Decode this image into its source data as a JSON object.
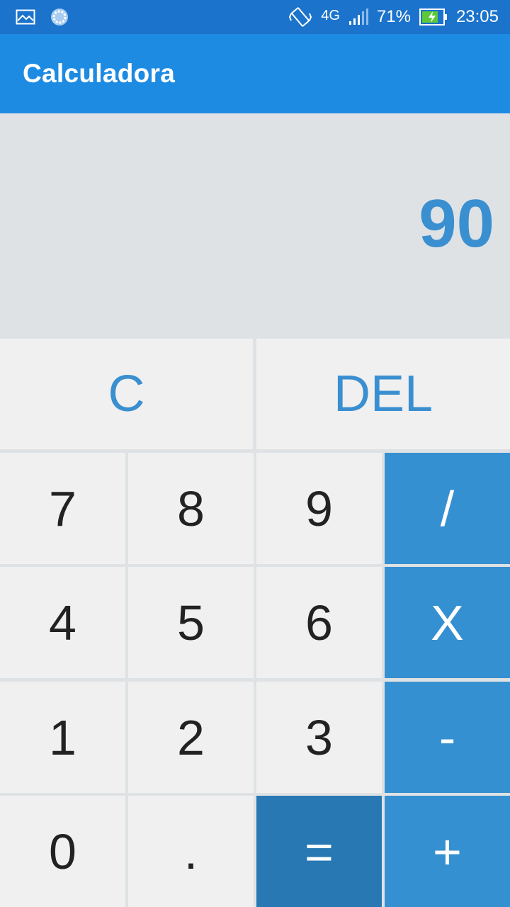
{
  "status_bar": {
    "network": "4G",
    "battery": "71%",
    "time": "23:05",
    "icons": [
      "gallery-icon",
      "sync-icon",
      "vibrate-icon",
      "signal-icon",
      "battery-charging-icon"
    ]
  },
  "app_bar": {
    "title": "Calculadora"
  },
  "display": {
    "value": "90"
  },
  "keys": {
    "clear": "C",
    "delete": "DEL",
    "seven": "7",
    "eight": "8",
    "nine": "9",
    "divide": "/",
    "four": "4",
    "five": "5",
    "six": "6",
    "multiply": "X",
    "one": "1",
    "two": "2",
    "three": "3",
    "minus": "-",
    "zero": "0",
    "dot": ".",
    "equals": "=",
    "plus": "+"
  },
  "colors": {
    "status_bar": "#1b73cc",
    "app_bar": "#1e8be3",
    "display_bg": "#dfe2e4",
    "accent_text": "#3a8fd0",
    "operator_key": "#3590d1",
    "equals_key": "#2878b3",
    "key_bg": "#f0f0f0"
  }
}
